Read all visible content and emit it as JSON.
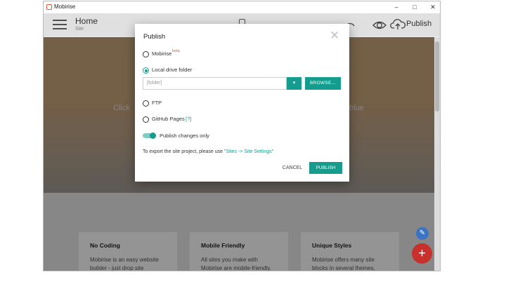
{
  "window": {
    "title": "Mobirise",
    "controls": {
      "minimize": "–",
      "maximize": "□",
      "close": "✕"
    }
  },
  "header": {
    "page_title": "Home",
    "page_subtitle": "Site",
    "publish_label": "Publish",
    "icons": [
      "hamburger-icon",
      "mobile-preview-icon",
      "undo-icon",
      "eye-icon",
      "cloud-upload-icon"
    ]
  },
  "hero": {
    "text_left": "Click",
    "text_right": "blue"
  },
  "cards": [
    {
      "title": "No Coding",
      "text_line1": "Mobirise is an easy website",
      "text_line2": "builder - just drop site"
    },
    {
      "title": "Mobile Friendly",
      "text_line1": "All sites you make with",
      "text_line2": "Mobirise are mobile-friendly."
    },
    {
      "title": "Unique Styles",
      "text_line1": "Mobirise offers many site",
      "text_line2": "blocks in several themes,"
    }
  ],
  "modal": {
    "title": "Publish",
    "close_glyph": "✕",
    "options": {
      "mobirise": {
        "label": "Mobirise",
        "badge": "beta",
        "selected": false
      },
      "local": {
        "label": "Local drive folder",
        "selected": true
      },
      "ftp": {
        "label": "FTP",
        "selected": false
      },
      "github": {
        "label": "GitHub Pages",
        "help": "[?]",
        "selected": false
      }
    },
    "folder_placeholder": "[folder]",
    "browse_label": "BROWSE...",
    "dropdown_glyph": "▾",
    "publish_changes_only": {
      "label": "Publish changes only",
      "enabled": true
    },
    "export_note": {
      "prefix": "To export the site project, please use ",
      "link": "\"Sites -> Site Settings\""
    },
    "cancel_label": "CANCEL",
    "publish_label": "PUBLISH"
  },
  "fabs": {
    "edit_glyph": "✎",
    "add_glyph": "+"
  },
  "colors": {
    "accent": "#149c8e",
    "fab_blue": "#3b74c5",
    "fab_red": "#c9302c",
    "logo": "#e0573e"
  }
}
